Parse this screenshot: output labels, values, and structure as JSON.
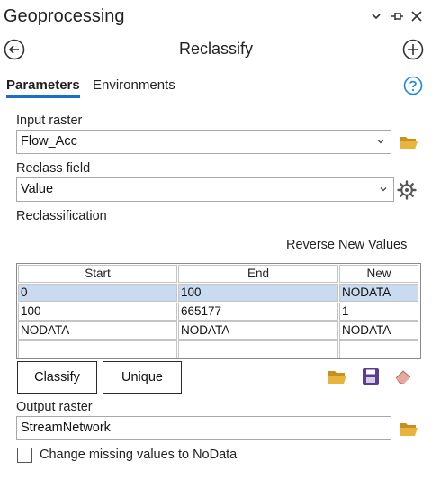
{
  "header": {
    "title": "Geoprocessing",
    "controls": [
      "chevron-down-icon",
      "pin-icon",
      "close-icon"
    ]
  },
  "nav": {
    "back_icon": "back-arrow-icon",
    "tool_title": "Reclassify",
    "add_icon": "add-icon"
  },
  "tabs": {
    "parameters": "Parameters",
    "environments": "Environments",
    "help_icon": "help-icon"
  },
  "params": {
    "input_raster_label": "Input raster",
    "input_raster_value": "Flow_Acc",
    "reclass_field_label": "Reclass field",
    "reclass_field_value": "Value",
    "reclassification_label": "Reclassification",
    "reverse_label": "Reverse New Values",
    "output_raster_label": "Output raster",
    "output_raster_value": "StreamNetwork",
    "missing_label": "Change missing values to NoData",
    "missing_checked": false
  },
  "table": {
    "columns": [
      "Start",
      "End",
      "New"
    ],
    "rows": [
      [
        "0",
        "100",
        "NODATA"
      ],
      [
        "100",
        "665177",
        "1"
      ],
      [
        "NODATA",
        "NODATA",
        "NODATA"
      ],
      [
        "",
        "",
        ""
      ]
    ],
    "selected_row": 0
  },
  "buttons": {
    "classify": "Classify",
    "unique": "Unique"
  },
  "colors": {
    "accent": "#1c6ec7",
    "selection": "#c9dcef",
    "folder": "#e0a82e",
    "save": "#5b3d8f"
  }
}
